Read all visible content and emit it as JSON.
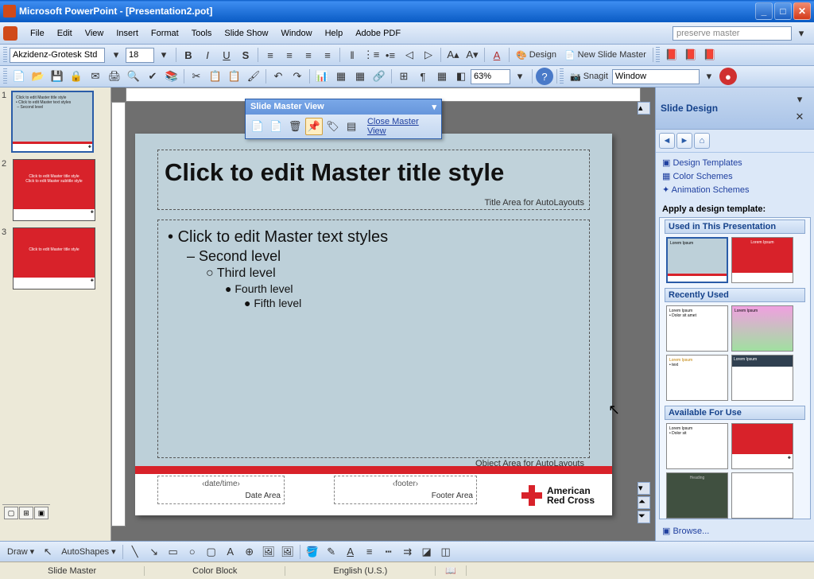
{
  "titlebar": {
    "app": "Microsoft PowerPoint",
    "doc": "[Presentation2.pot]"
  },
  "menus": [
    "File",
    "Edit",
    "View",
    "Insert",
    "Format",
    "Tools",
    "Slide Show",
    "Window",
    "Help",
    "Adobe PDF"
  ],
  "helpbox": "preserve master",
  "formatBar": {
    "font": "Akzidenz-Grotesk Std",
    "size": "18"
  },
  "designBtn": "Design",
  "newMasterBtn": "New Slide Master",
  "zoom": "63%",
  "snagitLabel": "Snagit",
  "snagitTarget": "Window",
  "masterToolbar": {
    "title": "Slide Master View",
    "close": "Close Master View"
  },
  "slide": {
    "title": "Click to edit Master title style",
    "titleSub": "Title Area for AutoLayouts",
    "body1": "Click to edit Master text styles",
    "body2": "Second level",
    "body3": "Third level",
    "body4": "Fourth level",
    "body5": "Fifth level",
    "bodySub": "Object Area for AutoLayouts",
    "dateLabel": "‹date/time›",
    "dateSub": "Date Area",
    "footerLabel": "‹footer›",
    "footerSub": "Footer Area",
    "logo1": "American",
    "logo2": "Red Cross"
  },
  "taskpane": {
    "title": "Slide Design",
    "linkTemplates": "Design Templates",
    "linkColors": "Color Schemes",
    "linkAnim": "Animation Schemes",
    "applyLabel": "Apply a design template:",
    "secUsed": "Used in This Presentation",
    "secRecent": "Recently Used",
    "secAvail": "Available For Use",
    "browse": "Browse..."
  },
  "drawLabel": "Draw",
  "autoshapesLabel": "AutoShapes",
  "status": {
    "left": "Slide Master",
    "mid": "Color Block",
    "lang": "English (U.S.)"
  }
}
